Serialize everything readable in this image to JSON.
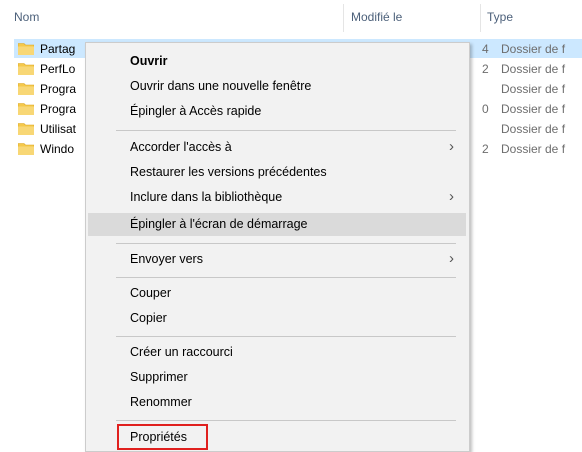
{
  "columns": {
    "name": "Nom",
    "modified": "Modifié le",
    "type": "Type"
  },
  "folders": [
    {
      "name": "Partag",
      "type": "Dossier de f",
      "frag": "4",
      "selected": true
    },
    {
      "name": "PerfLo",
      "type": "Dossier de f",
      "frag": "2",
      "selected": false
    },
    {
      "name": "Progra",
      "type": "Dossier de f",
      "frag": "",
      "selected": false
    },
    {
      "name": "Progra",
      "type": "Dossier de f",
      "frag": "0",
      "selected": false
    },
    {
      "name": "Utilisat",
      "type": "Dossier de f",
      "frag": "",
      "selected": false
    },
    {
      "name": "Windo",
      "type": "Dossier de f",
      "frag": "2",
      "selected": false
    }
  ],
  "menu": {
    "open": "Ouvrir",
    "open_new_window": "Ouvrir dans une nouvelle fenêtre",
    "pin_quick_access": "Épingler à Accès rapide",
    "grant_access": "Accorder l'accès à",
    "restore_versions": "Restaurer les versions précédentes",
    "include_library": "Inclure dans la bibliothèque",
    "pin_start": "Épingler à l'écran de démarrage",
    "send_to": "Envoyer vers",
    "cut": "Couper",
    "copy": "Copier",
    "create_shortcut": "Créer un raccourci",
    "delete": "Supprimer",
    "rename": "Renommer",
    "properties": "Propriétés",
    "submenu_arrow": "›"
  },
  "colors": {
    "selection": "#cce8ff",
    "folder": "#f5c84a",
    "highlight_border": "#e0201e"
  }
}
